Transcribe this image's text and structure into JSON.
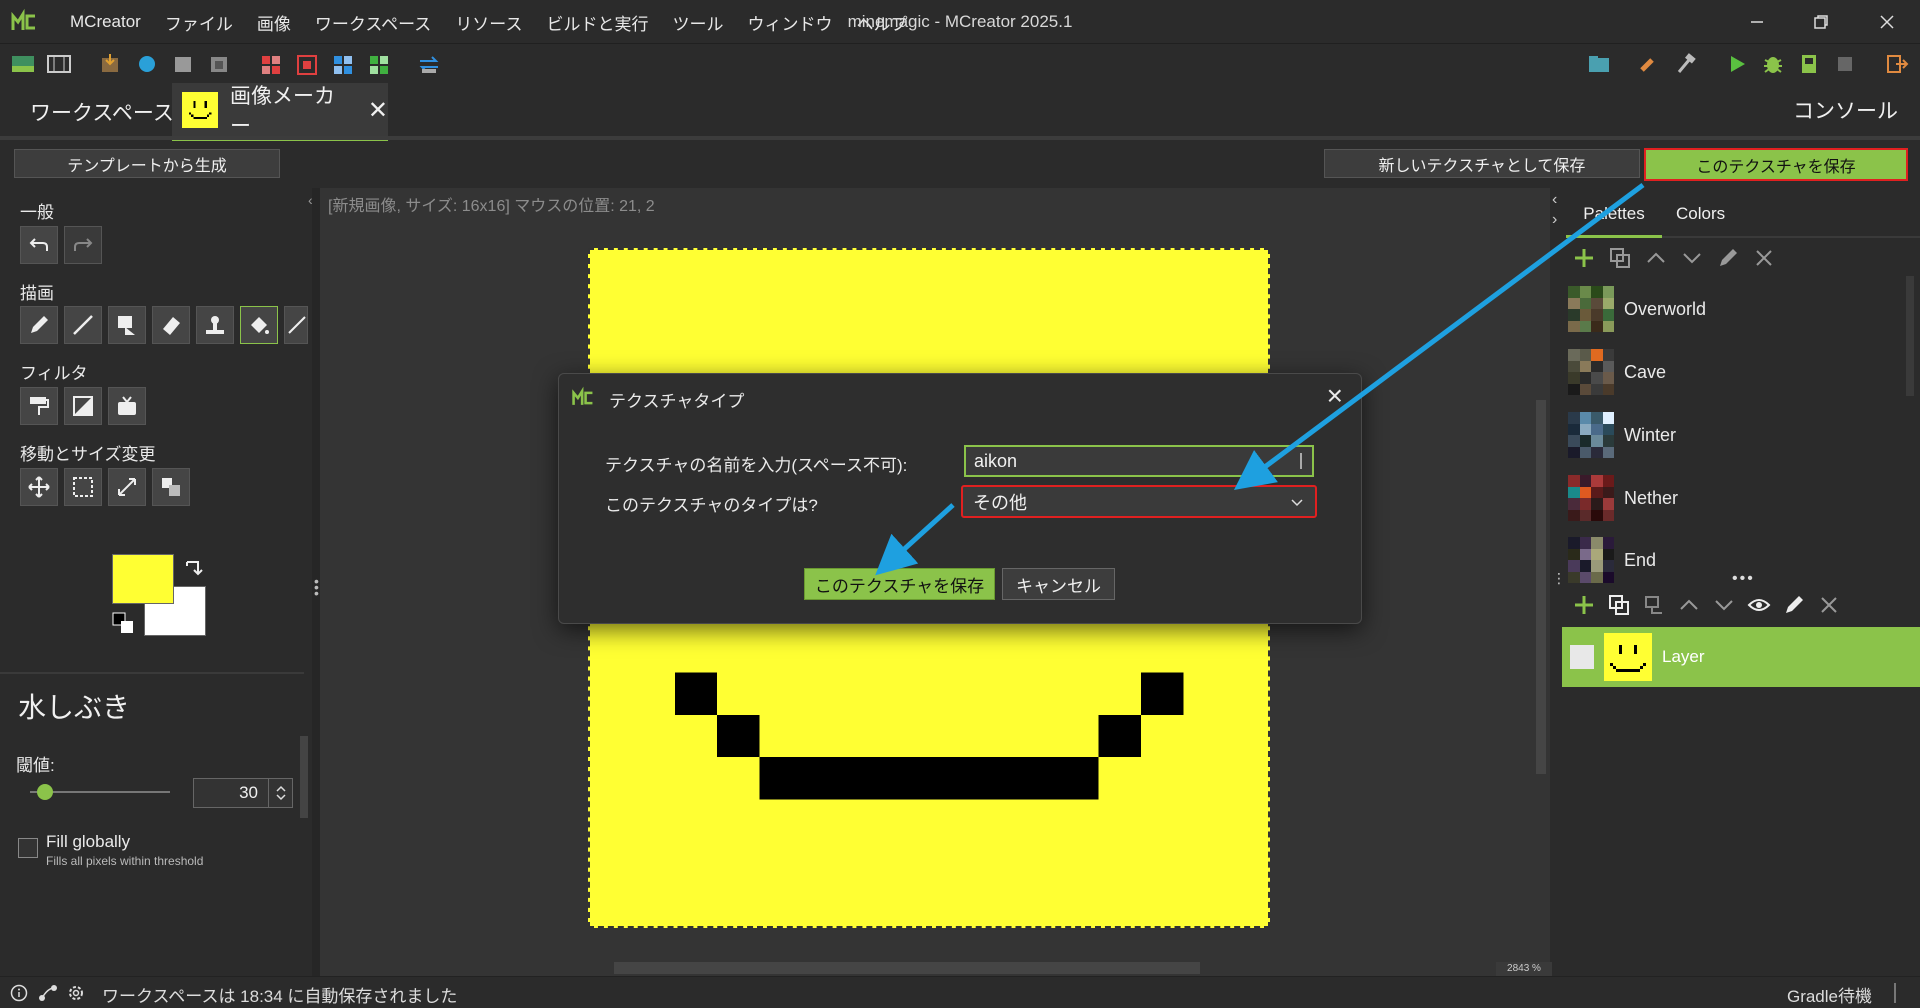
{
  "app": {
    "menu": [
      "MCreator",
      "ファイル",
      "画像",
      "ワークスペース",
      "リソース",
      "ビルドと実行",
      "ツール",
      "ウィンドウ",
      "ヘルプ"
    ],
    "window_title": "minemagic - MCreator 2025.1",
    "accent": "#8bc34a",
    "highlight": "#e02020",
    "annotation_arrow": "#1ea0e0"
  },
  "tabs": {
    "workspace": "ワークスペース",
    "image_maker": "画像メーカー",
    "console": "コンソール"
  },
  "actions": {
    "template": "テンプレートから生成",
    "save_new": "新しいテクスチャとして保存",
    "save": "このテクスチャを保存"
  },
  "leftpanel": {
    "general": "一般",
    "draw": "描画",
    "filter": "フィルタ",
    "move_resize": "移動とサイズ変更",
    "primary_color": "#ffff33",
    "secondary_color": "#ffffff",
    "tool_name": "水しぶき",
    "threshold_label": "閾値:",
    "threshold_value": "30",
    "fill_globally": "Fill globally",
    "fill_hint": "Fills all pixels within threshold"
  },
  "canvas": {
    "info": "[新規画像, サイズ: 16x16] マウスの位置: 21, 2",
    "zoom": "2843 %",
    "fill": "#ffff33"
  },
  "rightpanel": {
    "tabs": [
      "Palettes",
      "Colors"
    ],
    "palettes": [
      "Overworld",
      "Cave",
      "Winter",
      "Nether",
      "End"
    ],
    "layer_name": "Layer"
  },
  "dialog": {
    "title": "テクスチャタイプ",
    "name_label": "テクスチャの名前を入力(スペース不可):",
    "name_value": "aikon",
    "type_label": "このテクスチャのタイプは?",
    "type_value": "その他",
    "save": "このテクスチャを保存",
    "cancel": "キャンセル"
  },
  "status": {
    "text": "ワークスペースは 18:34 に自動保存されました",
    "gradle": "Gradle待機"
  }
}
